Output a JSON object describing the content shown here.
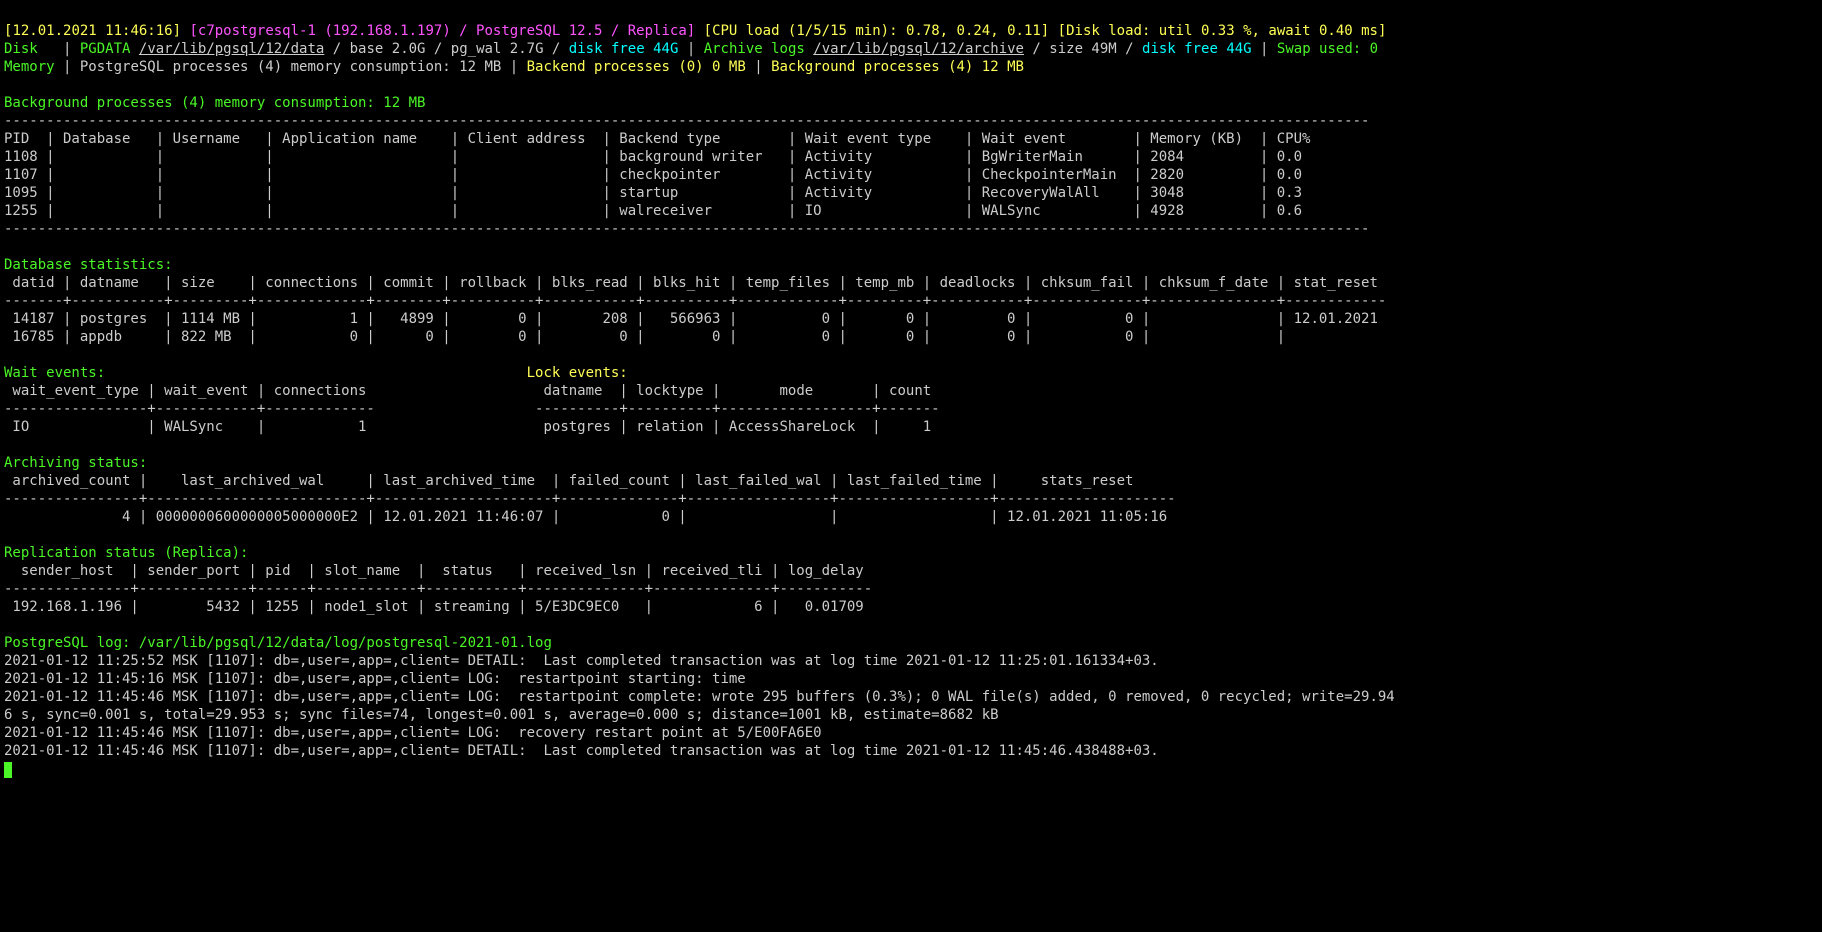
{
  "header": {
    "timestamp_open": "[",
    "timestamp": "12.01.2021 11:46:16",
    "timestamp_close": "]",
    "host_open": " [",
    "host": "c7postgresql-1 (192.168.1.197) / PostgreSQL 12.5 / Replica",
    "host_close": "]",
    "cpu_open": " [",
    "cpu_label": "CPU load (1/5/15 min): ",
    "cpu_values": "0.78, 0.24, 0.11",
    "cpu_close": "]",
    "disk_open": " [",
    "disk_label": "Disk load: util ",
    "disk_util": "0.33 %",
    "disk_await_label": ", await ",
    "disk_await": "0.40 ms",
    "disk_close": "]"
  },
  "disk_line": {
    "disk_label": "Disk  ",
    "pipe1": " | ",
    "pgdata_label": "PGDATA ",
    "pgdata_path": "/var/lib/pgsql/12/data",
    "base_sep": " / ",
    "base": "base 2.0G",
    "pgwal_sep": " / ",
    "pgwal": "pg_wal 2.7G",
    "df_sep": " / ",
    "df_label": "disk free ",
    "df_value": "44G",
    "pipe2": " | ",
    "archive_label": "Archive logs ",
    "archive_path": "/var/lib/pgsql/12/archive",
    "size_sep": " / ",
    "size": "size 49M",
    "adf_sep": " / ",
    "adf_label": "disk free ",
    "adf_value": "44G",
    "pipe3": " | ",
    "swap_label": "Swap used: ",
    "swap_value": "0"
  },
  "memory_line": {
    "mem_label": "Memory",
    "pipe1": " | ",
    "pg_proc": "PostgreSQL processes (4) memory consumption: 12 MB",
    "pipe2": " | ",
    "backend": "Backend processes (0) 0 MB",
    "pipe3": " | ",
    "background": "Background processes (4) 12 MB"
  },
  "bg_title": "Background processes (4) memory consumption: 12 MB",
  "bg_header": "PID  | Database   | Username   | Application name    | Client address  | Backend type        | Wait event type    | Wait event        | Memory (KB)  | CPU%",
  "bg_rows": [
    "1108 |            |            |                     |                 | background writer   | Activity           | BgWriterMain      | 2084         | 0.0",
    "1107 |            |            |                     |                 | checkpointer        | Activity           | CheckpointerMain  | 2820         | 0.0",
    "1095 |            |            |                     |                 | startup             | Activity           | RecoveryWalAll    | 3048         | 0.3",
    "1255 |            |            |                     |                 | walreceiver         | IO                 | WALSync           | 4928         | 0.6"
  ],
  "db_stats_title": "Database statistics:",
  "db_stats_header": " datid | datname   | size    | connections | commit | rollback | blks_read | blks_hit | temp_files | temp_mb | deadlocks | chksum_fail | chksum_f_date | stat_reset ",
  "db_stats_sep": "-------+-----------+---------+-------------+--------+----------+-----------+----------+------------+---------+-----------+-------------+---------------+------------",
  "db_stats_rows": [
    " 14187 | postgres  | 1114 MB |           1 |   4899 |        0 |       208 |   566963 |          0 |       0 |         0 |           0 |               | 12.01.2021",
    " 16785 | appdb     | 822 MB  |           0 |      0 |        0 |         0 |        0 |          0 |       0 |         0 |           0 |               | "
  ],
  "wait_title": "Wait events:",
  "lock_title": "Lock events:",
  "wait_header": " wait_event_type | wait_event | connections ",
  "lock_header": " datname  | locktype |       mode       | count ",
  "wait_sep": "-----------------+------------+-------------",
  "lock_sep": "----------+----------+------------------+-------",
  "wait_row": " IO              | WALSync    |           1 ",
  "lock_row": " postgres | relation | AccessShareLock  |     1 ",
  "archive_title": "Archiving status:",
  "archive_header": " archived_count |    last_archived_wal     | last_archived_time  | failed_count | last_failed_wal | last_failed_time |     stats_reset     ",
  "archive_sep": "----------------+--------------------------+---------------------+--------------+-----------------+------------------+---------------------",
  "archive_row": "              4 | 0000000600000005000000E2 | 12.01.2021 11:46:07 |            0 |                 |                  | 12.01.2021 11:05:16",
  "repl_title": "Replication status (Replica):",
  "repl_header": "  sender_host  | sender_port | pid  | slot_name  |  status   | received_lsn | received_tli | log_delay ",
  "repl_sep": "---------------+-------------+------+------------+-----------+--------------+--------------+-----------",
  "repl_row": " 192.168.1.196 |        5432 | 1255 | node1_slot | streaming | 5/E3DC9EC0   |            6 |   0.01709",
  "log_title_prefix": "PostgreSQL log: ",
  "log_path": "/var/lib/pgsql/12/data/log/postgresql-2021-01.log",
  "log_lines": [
    "2021-01-12 11:25:52 MSK [1107]: db=,user=,app=,client= DETAIL:  Last completed transaction was at log time 2021-01-12 11:25:01.161334+03.",
    "2021-01-12 11:45:16 MSK [1107]: db=,user=,app=,client= LOG:  restartpoint starting: time",
    "2021-01-12 11:45:46 MSK [1107]: db=,user=,app=,client= LOG:  restartpoint complete: wrote 295 buffers (0.3%); 0 WAL file(s) added, 0 removed, 0 recycled; write=29.94",
    "6 s, sync=0.001 s, total=29.953 s; sync files=74, longest=0.001 s, average=0.000 s; distance=1001 kB, estimate=8682 kB",
    "2021-01-12 11:45:46 MSK [1107]: db=,user=,app=,client= LOG:  recovery restart point at 5/E00FA6E0",
    "2021-01-12 11:45:46 MSK [1107]: db=,user=,app=,client= DETAIL:  Last completed transaction was at log time 2021-01-12 11:45:46.438488+03."
  ],
  "long_dash": "------------------------------------------------------------------------------------------------------------------------------------------------------------------"
}
